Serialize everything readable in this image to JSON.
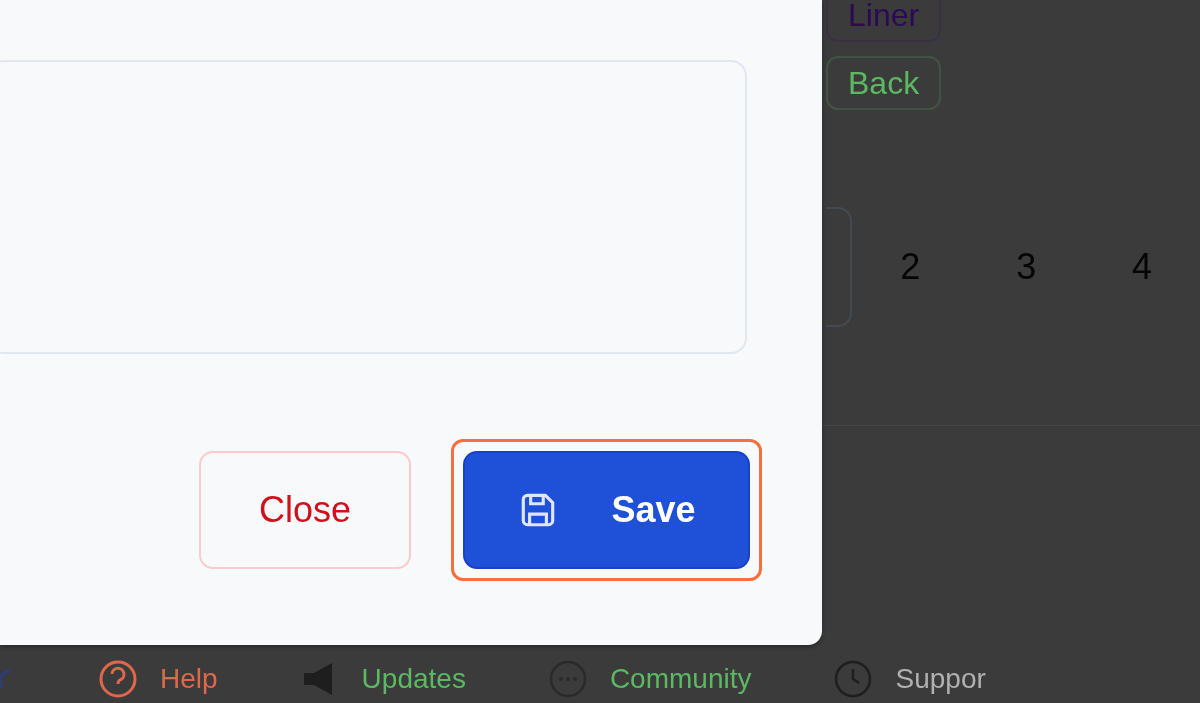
{
  "background": {
    "chips": [
      {
        "label": "Liner",
        "color": "#2a0a55"
      },
      {
        "label": "Back",
        "color": "#5cb862"
      }
    ],
    "pages": [
      {
        "label": "2",
        "selected": false
      },
      {
        "label": "3",
        "selected": false
      },
      {
        "label": "4",
        "selected": false
      }
    ],
    "footer": [
      {
        "label": "Help",
        "kind": "help",
        "color": "#e0684a"
      },
      {
        "label": "Updates",
        "kind": "news",
        "color": "#5cb862"
      },
      {
        "label": "Community",
        "kind": "community",
        "color": "#5cb862"
      },
      {
        "label": "Suppor",
        "kind": "support",
        "color": "#b0b0b0"
      }
    ]
  },
  "dialog": {
    "buttons": [
      {
        "label": "Close",
        "kind": "secondary",
        "highlighted": false
      },
      {
        "label": "Save",
        "kind": "primary",
        "highlighted": true
      }
    ]
  }
}
